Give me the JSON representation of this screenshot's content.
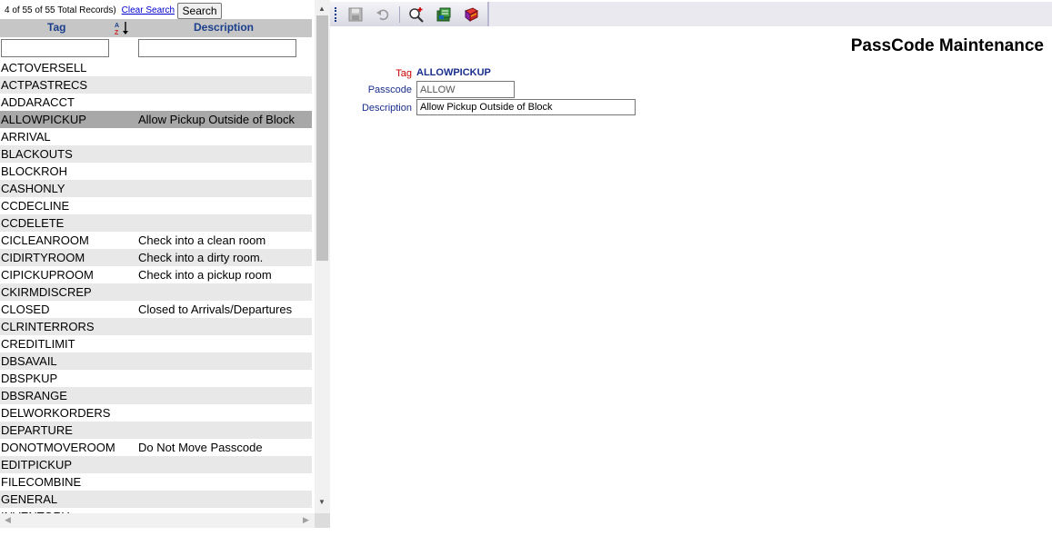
{
  "search": {
    "record_count": "4 of 55 of 55 Total Records)",
    "clear_label": "Clear Search",
    "button_label": "Search",
    "tag_filter": "",
    "desc_filter": ""
  },
  "grid": {
    "columns": {
      "tag": "Tag",
      "description": "Description"
    },
    "rows": [
      {
        "tag": "ACTOVERSELL",
        "desc": ""
      },
      {
        "tag": "ACTPASTRECS",
        "desc": ""
      },
      {
        "tag": "ADDARACCT",
        "desc": ""
      },
      {
        "tag": "ALLOWPICKUP",
        "desc": "Allow Pickup Outside of Block"
      },
      {
        "tag": "ARRIVAL",
        "desc": ""
      },
      {
        "tag": "BLACKOUTS",
        "desc": ""
      },
      {
        "tag": "BLOCKROH",
        "desc": ""
      },
      {
        "tag": "CASHONLY",
        "desc": ""
      },
      {
        "tag": "CCDECLINE",
        "desc": ""
      },
      {
        "tag": "CCDELETE",
        "desc": ""
      },
      {
        "tag": "CICLEANROOM",
        "desc": "Check into a clean room"
      },
      {
        "tag": "CIDIRTYROOM",
        "desc": "Check into a dirty room."
      },
      {
        "tag": "CIPICKUPROOM",
        "desc": "Check into a pickup room"
      },
      {
        "tag": "CKIRMDISCREP",
        "desc": ""
      },
      {
        "tag": "CLOSED",
        "desc": "Closed to Arrivals/Departures"
      },
      {
        "tag": "CLRINTERRORS",
        "desc": ""
      },
      {
        "tag": "CREDITLIMIT",
        "desc": ""
      },
      {
        "tag": "DBSAVAIL",
        "desc": ""
      },
      {
        "tag": "DBSPKUP",
        "desc": ""
      },
      {
        "tag": "DBSRANGE",
        "desc": ""
      },
      {
        "tag": "DELWORKORDERS",
        "desc": ""
      },
      {
        "tag": "DEPARTURE",
        "desc": ""
      },
      {
        "tag": "DONOTMOVEROOM",
        "desc": "Do Not Move Passcode"
      },
      {
        "tag": "EDITPICKUP",
        "desc": ""
      },
      {
        "tag": "FILECOMBINE",
        "desc": ""
      },
      {
        "tag": "GENERAL",
        "desc": ""
      },
      {
        "tag": "INVENTORY",
        "desc": ""
      }
    ],
    "selected_index": 3
  },
  "toolbar": {
    "icons": [
      "save-icon",
      "undo-icon",
      "add-search-icon",
      "report-icon",
      "help-book-icon"
    ]
  },
  "form": {
    "title": "PassCode Maintenance",
    "tag_label": "Tag",
    "tag_value": "ALLOWPICKUP",
    "passcode_label": "Passcode",
    "passcode_value": "ALLOW",
    "description_label": "Description",
    "description_value": "Allow Pickup Outside of Block"
  },
  "colors": {
    "header_bg": "#c6c6c6",
    "header_text": "#1a3e8c",
    "selected_row": "#a8a8a8",
    "alt_row": "#e8e8e8",
    "tag_label": "#cc0000",
    "field_label": "#1a2f8c"
  }
}
